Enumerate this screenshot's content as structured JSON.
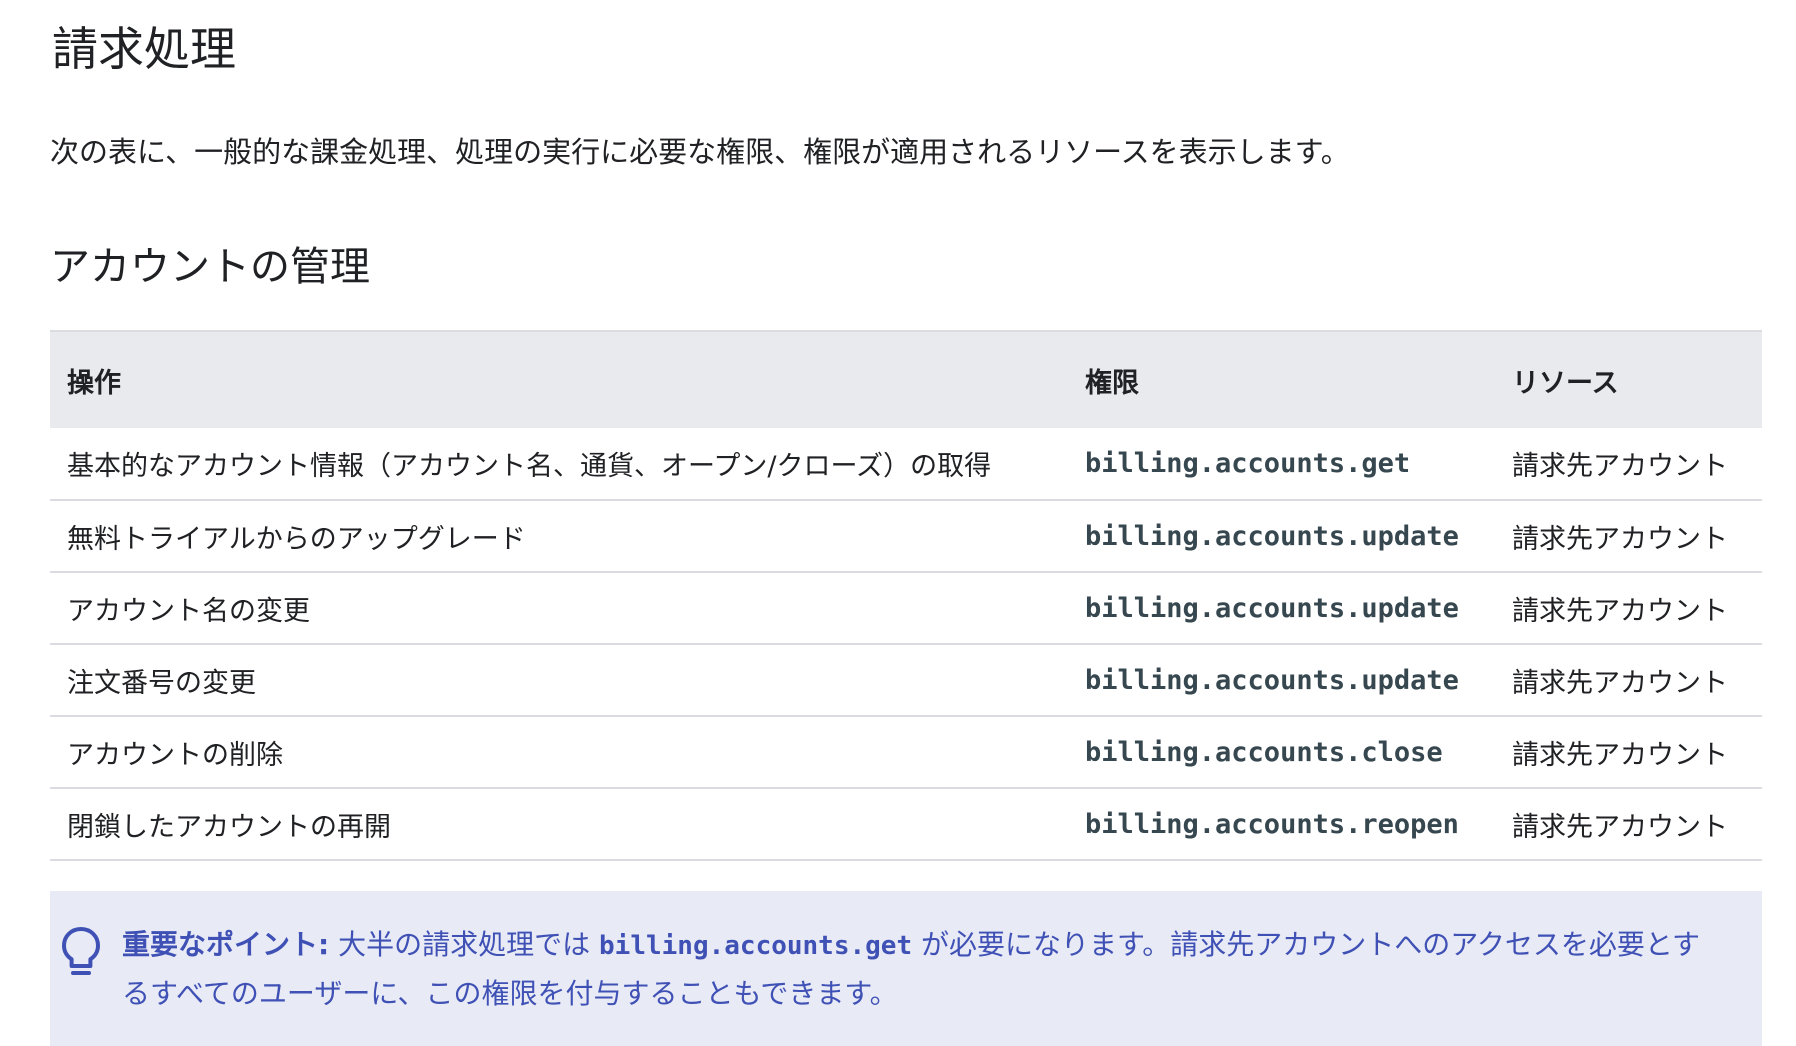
{
  "page": {
    "title": "請求処理",
    "intro": "次の表に、一般的な課金処理、処理の実行に必要な権限、権限が適用されるリソースを表示します。"
  },
  "section": {
    "title": "アカウントの管理"
  },
  "table": {
    "headers": [
      "操作",
      "権限",
      "リソース"
    ],
    "rows": [
      {
        "operation": "基本的なアカウント情報（アカウント名、通貨、オープン/クローズ）の取得",
        "permission": "billing.accounts.get",
        "resource": "請求先アカウント"
      },
      {
        "operation": "無料トライアルからのアップグレード",
        "permission": "billing.accounts.update",
        "resource": "請求先アカウント"
      },
      {
        "operation": "アカウント名の変更",
        "permission": "billing.accounts.update",
        "resource": "請求先アカウント"
      },
      {
        "operation": "注文番号の変更",
        "permission": "billing.accounts.update",
        "resource": "請求先アカウント"
      },
      {
        "operation": "アカウントの削除",
        "permission": "billing.accounts.close",
        "resource": "請求先アカウント"
      },
      {
        "operation": "閉鎖したアカウントの再開",
        "permission": "billing.accounts.reopen",
        "resource": "請求先アカウント"
      }
    ]
  },
  "note": {
    "icon": "lightbulb-icon",
    "label": "重要なポイント:",
    "text_before": "大半の請求処理では",
    "code": "billing.accounts.get",
    "text_after": "が必要になります。請求先アカウントへのアクセスを必要とするすべてのユーザーに、この権限を付与することもできます。",
    "color": "#3f51b5",
    "background": "#e8eaf6"
  },
  "colors": {
    "header_bg": "#e8eaed",
    "border": "#dadce0",
    "text": "#202124",
    "code_text": "#37474f"
  }
}
